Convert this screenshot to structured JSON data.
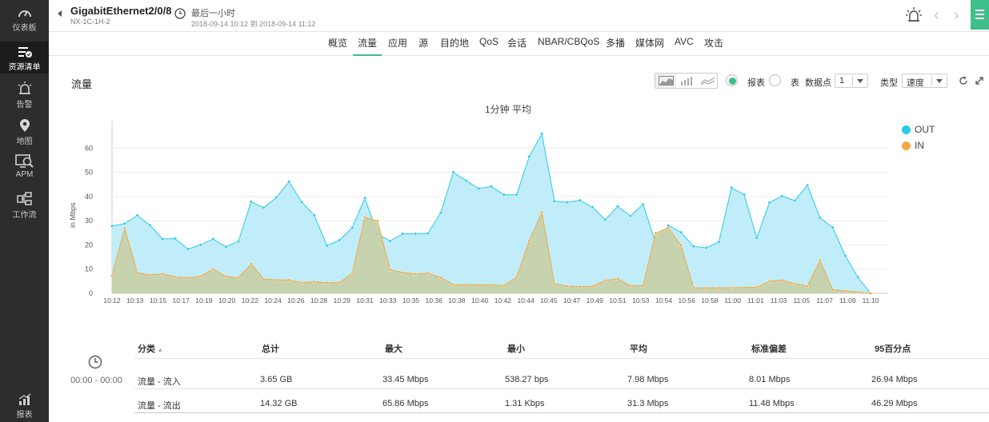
{
  "sidebar": {
    "items": [
      {
        "label": "仪表板",
        "icon": "dashboard-icon"
      },
      {
        "label": "资源清单",
        "icon": "inventory-icon",
        "active": true
      },
      {
        "label": "告警",
        "icon": "alarm-icon"
      },
      {
        "label": "地图",
        "icon": "map-pin-icon"
      },
      {
        "label": "APM",
        "icon": "apm-icon"
      },
      {
        "label": "工作流",
        "icon": "workflow-icon"
      },
      {
        "label": "报表",
        "icon": "report-icon"
      }
    ]
  },
  "header": {
    "device_name": "GigabitEthernet2/0/8",
    "device_sub": "NX-1C-1H-2",
    "time_range_label": "最后一小时",
    "time_range_dates": "2018-09-14 10:12 到 2018-09-14 11:12"
  },
  "tabs": [
    "概览",
    "流量",
    "应用",
    "源",
    "目的地",
    "QoS",
    "会话",
    "NBAR/CBQoS",
    "多播",
    "媒体网",
    "AVC",
    "攻击"
  ],
  "active_tab": "流量",
  "panel": {
    "title": "流量",
    "view_report_label": "报表",
    "view_table_label": "表",
    "datapoints_label": "数据点",
    "datapoints_value": "1",
    "type_label": "类型",
    "type_value": "速度"
  },
  "colors": {
    "out": "#29c9e8",
    "out_fill": "#b9ebf8",
    "in": "#f5a742",
    "in_fill": "#c8cfa6",
    "accent": "#3fbf8a"
  },
  "chart_data": {
    "type": "area",
    "title": "1分钟 平均",
    "ylabel": "in Mbps",
    "ylim": [
      0,
      70
    ],
    "yticks": [
      0,
      10,
      20,
      30,
      40,
      50,
      60
    ],
    "grid": true,
    "legend_position": "right",
    "x_tick_labels": [
      "10:12",
      "10:13",
      "10:15",
      "10:17",
      "10:19",
      "10:20",
      "10:22",
      "10:24",
      "10:26",
      "10:28",
      "10:29",
      "10:31",
      "10:33",
      "10:35",
      "10:36",
      "10:38",
      "10:40",
      "10:42",
      "10:44",
      "10:45",
      "10:47",
      "10:49",
      "10:51",
      "10:53",
      "10:54",
      "10:56",
      "10:58",
      "11:00",
      "11:01",
      "11:03",
      "11:05",
      "11:07",
      "11:09",
      "11:10"
    ],
    "series": [
      {
        "name": "OUT",
        "values": [
          27.8,
          28.8,
          32.2,
          28.1,
          22.5,
          22.6,
          18.3,
          20.0,
          22.4,
          19.2,
          21.5,
          37.8,
          35.4,
          39.6,
          46.1,
          37.7,
          32.2,
          19.7,
          22.0,
          27.1,
          39.3,
          24.4,
          21.6,
          24.6,
          24.6,
          24.8,
          33.3,
          50.0,
          46.6,
          43.3,
          44.1,
          40.7,
          40.7,
          56.5,
          65.9,
          38.1,
          37.6,
          38.4,
          35.6,
          30.4,
          35.9,
          32.0,
          36.7,
          21.0,
          28.0,
          25.2,
          19.4,
          18.8,
          21.2,
          43.6,
          40.7,
          22.9,
          37.5,
          40.2,
          38.3,
          44.6,
          31.2,
          27.2,
          15.5,
          6.6,
          0
        ]
      },
      {
        "name": "IN",
        "values": [
          7.3,
          26.8,
          8.5,
          7.6,
          8.0,
          6.8,
          6.4,
          7.0,
          10.0,
          7.0,
          6.4,
          12.1,
          5.9,
          5.5,
          5.5,
          4.4,
          4.8,
          4.4,
          4.4,
          8.3,
          31.4,
          29.9,
          9.7,
          8.6,
          8.0,
          8.3,
          6.5,
          3.6,
          3.5,
          3.5,
          3.5,
          3.2,
          6.6,
          21.8,
          33.4,
          3.9,
          3.0,
          2.7,
          2.9,
          5.3,
          6.0,
          3.1,
          3.2,
          24.9,
          27.0,
          19.9,
          2.2,
          2.2,
          2.2,
          2.3,
          2.4,
          2.5,
          5.0,
          5.4,
          4.0,
          3.0,
          13.5,
          1.5,
          1.0,
          0.5,
          0
        ]
      }
    ]
  },
  "time_filter": "00:00 - 00:00",
  "table": {
    "headers": [
      "分类",
      "总计",
      "最大",
      "最小",
      "平均",
      "标准偏差",
      "95百分点"
    ],
    "rows": [
      [
        "流量 - 流入",
        "3.65 GB",
        "33.45 Mbps",
        "538.27 bps",
        "7.98 Mbps",
        "8.01 Mbps",
        "26.94 Mbps"
      ],
      [
        "流量 - 流出",
        "14.32 GB",
        "65.86 Mbps",
        "1.31 Kbps",
        "31.3 Mbps",
        "11.48 Mbps",
        "46.29 Mbps"
      ]
    ]
  }
}
